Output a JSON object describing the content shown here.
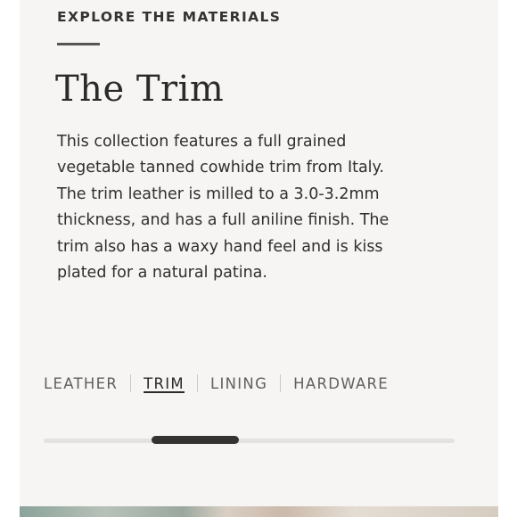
{
  "section": {
    "eyebrow": "EXPLORE THE MATERIALS",
    "title": "The Trim",
    "description": "This collection features a full grained vegetable tanned cowhide trim from Italy. The trim leather is milled to a 3.0-3.2mm thickness, and has a full aniline finish. The trim also has a waxy hand feel and is kiss plated for a natural patina."
  },
  "tabs": {
    "items": [
      {
        "label": "LEATHER"
      },
      {
        "label": "TRIM"
      },
      {
        "label": "LINING"
      },
      {
        "label": "HARDWARE"
      }
    ],
    "active": "TRIM"
  },
  "carousel": {
    "position": 0.26,
    "visible_fraction": 0.21
  },
  "colors": {
    "panel_background": "#f6f5f3",
    "text": "#2f2f2f",
    "scroll_thumb": "#333333",
    "scroll_track": "#e2e2e2"
  }
}
